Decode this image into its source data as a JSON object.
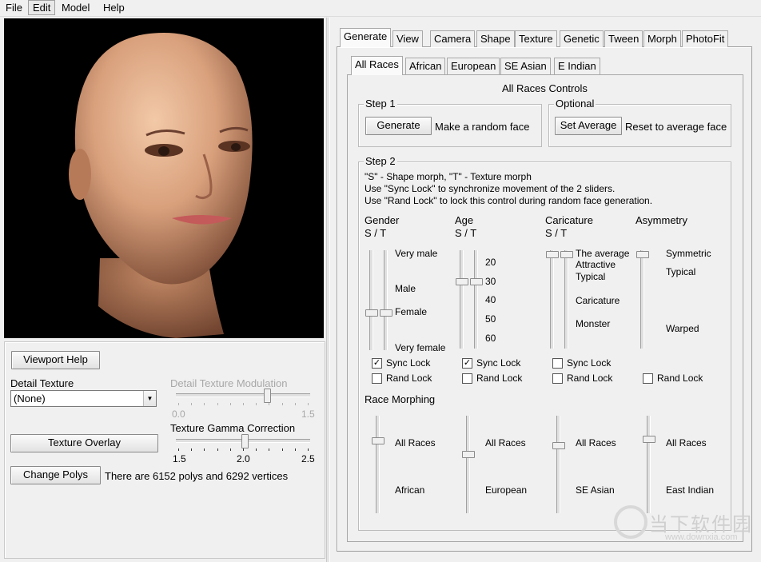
{
  "menu": {
    "items": [
      "File",
      "Edit",
      "Model",
      "Help"
    ]
  },
  "left": {
    "viewport_help": "Viewport Help",
    "detail_texture_label": "Detail Texture",
    "detail_texture_value": "(None)",
    "detail_mod_label": "Detail Texture Modulation",
    "detail_mod_min": "0.0",
    "detail_mod_max": "1.5",
    "detail_mod_value": 1.1,
    "gamma_label": "Texture Gamma Correction",
    "gamma_min": "1.5",
    "gamma_mid": "2.0",
    "gamma_max": "2.5",
    "gamma_value": 2.0,
    "texture_overlay": "Texture Overlay",
    "change_polys": "Change Polys",
    "poly_info": "There are 6152 polys and 6292 vertices"
  },
  "tabs": [
    "Generate",
    "View",
    "Camera",
    "Shape",
    "Texture",
    "Genetic",
    "Tween",
    "Morph",
    "PhotoFit"
  ],
  "subtabs": [
    "All Races",
    "African",
    "European",
    "SE Asian",
    "E Indian"
  ],
  "controls": {
    "heading": "All Races Controls",
    "step1": "Step 1",
    "generate": "Generate",
    "generate_desc": "Make a random face",
    "optional": "Optional",
    "set_average": "Set Average",
    "set_average_desc": "Reset to average face",
    "step2": "Step 2",
    "info1": "\"S\" - Shape morph, \"T\" - Texture morph",
    "info2": "Use \"Sync Lock\" to synchronize movement of the 2 sliders.",
    "info3": "Use \"Rand Lock\" to lock this control during random face generation."
  },
  "sliders": {
    "gender": {
      "title": "Gender",
      "st": "S / T",
      "labels": [
        "Very male",
        "Male",
        "Female",
        "Very female"
      ]
    },
    "age": {
      "title": "Age",
      "st": "S / T",
      "labels": [
        "20",
        "30",
        "40",
        "50",
        "60"
      ]
    },
    "caricature": {
      "title": "Caricature",
      "st": "S / T",
      "labels": [
        "The average",
        "Attractive",
        "Typical",
        "Caricature",
        "Monster"
      ]
    },
    "asymmetry": {
      "title": "Asymmetry",
      "labels": [
        "Symmetric",
        "Typical",
        "Warped"
      ]
    }
  },
  "locks": {
    "sync": "Sync Lock",
    "rand": "Rand Lock",
    "sync_checked": [
      true,
      true,
      false
    ]
  },
  "race": {
    "title": "Race Morphing",
    "top": [
      "All Races",
      "All Races",
      "All Races",
      "All Races"
    ],
    "bottom": [
      "African",
      "European",
      "SE Asian",
      "East Indian"
    ]
  },
  "watermark": {
    "text": "当下软件园",
    "url": "www.downxia.com"
  }
}
